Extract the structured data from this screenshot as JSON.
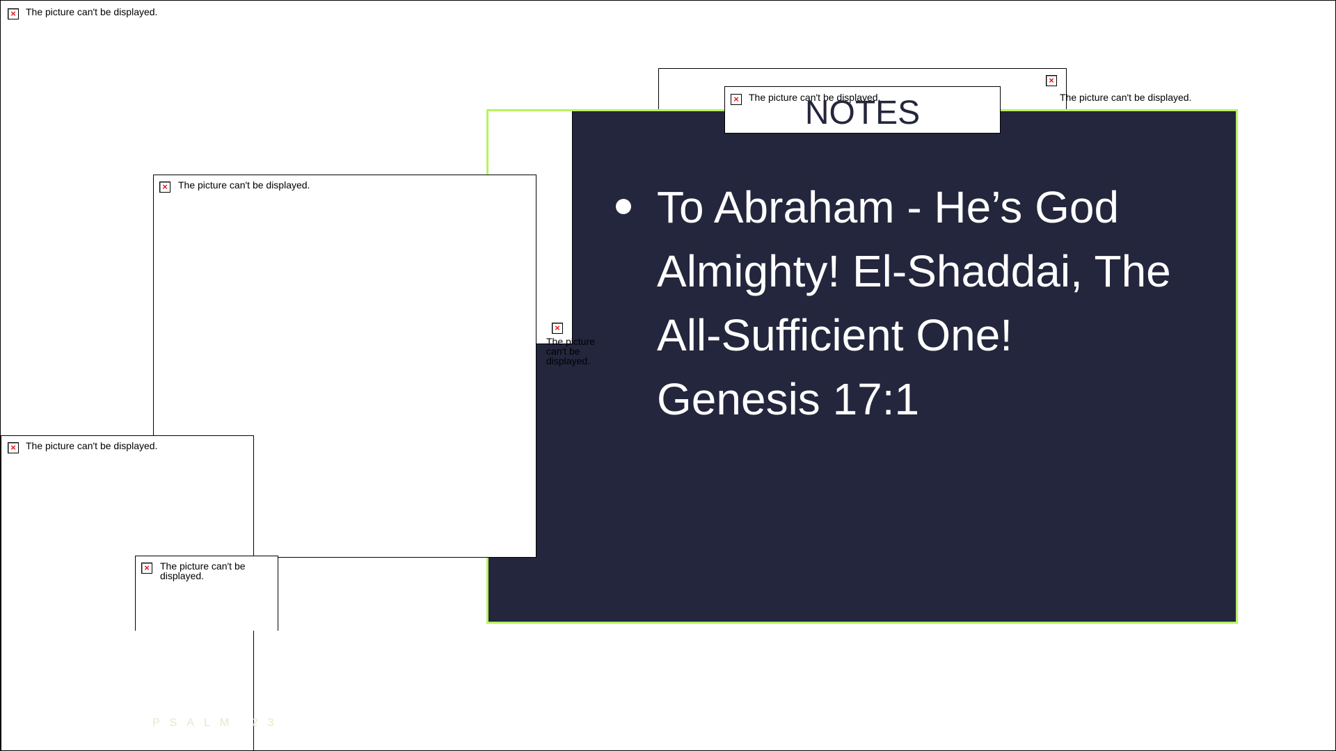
{
  "placeholder_text": "The picture can't be displayed.",
  "error_icon_glyph": "×",
  "notes": {
    "title": "NOTES",
    "bullet_text": "To Abraham - He’s God\nAlmighty! El-Shaddai, The\nAll-Sufficient One!\nGenesis 17:1"
  },
  "footer": {
    "psalm_label": "PSALM 23"
  },
  "colors": {
    "panel_background": "#24263d",
    "panel_border": "#b6f361",
    "error_icon": "#e8141b"
  }
}
